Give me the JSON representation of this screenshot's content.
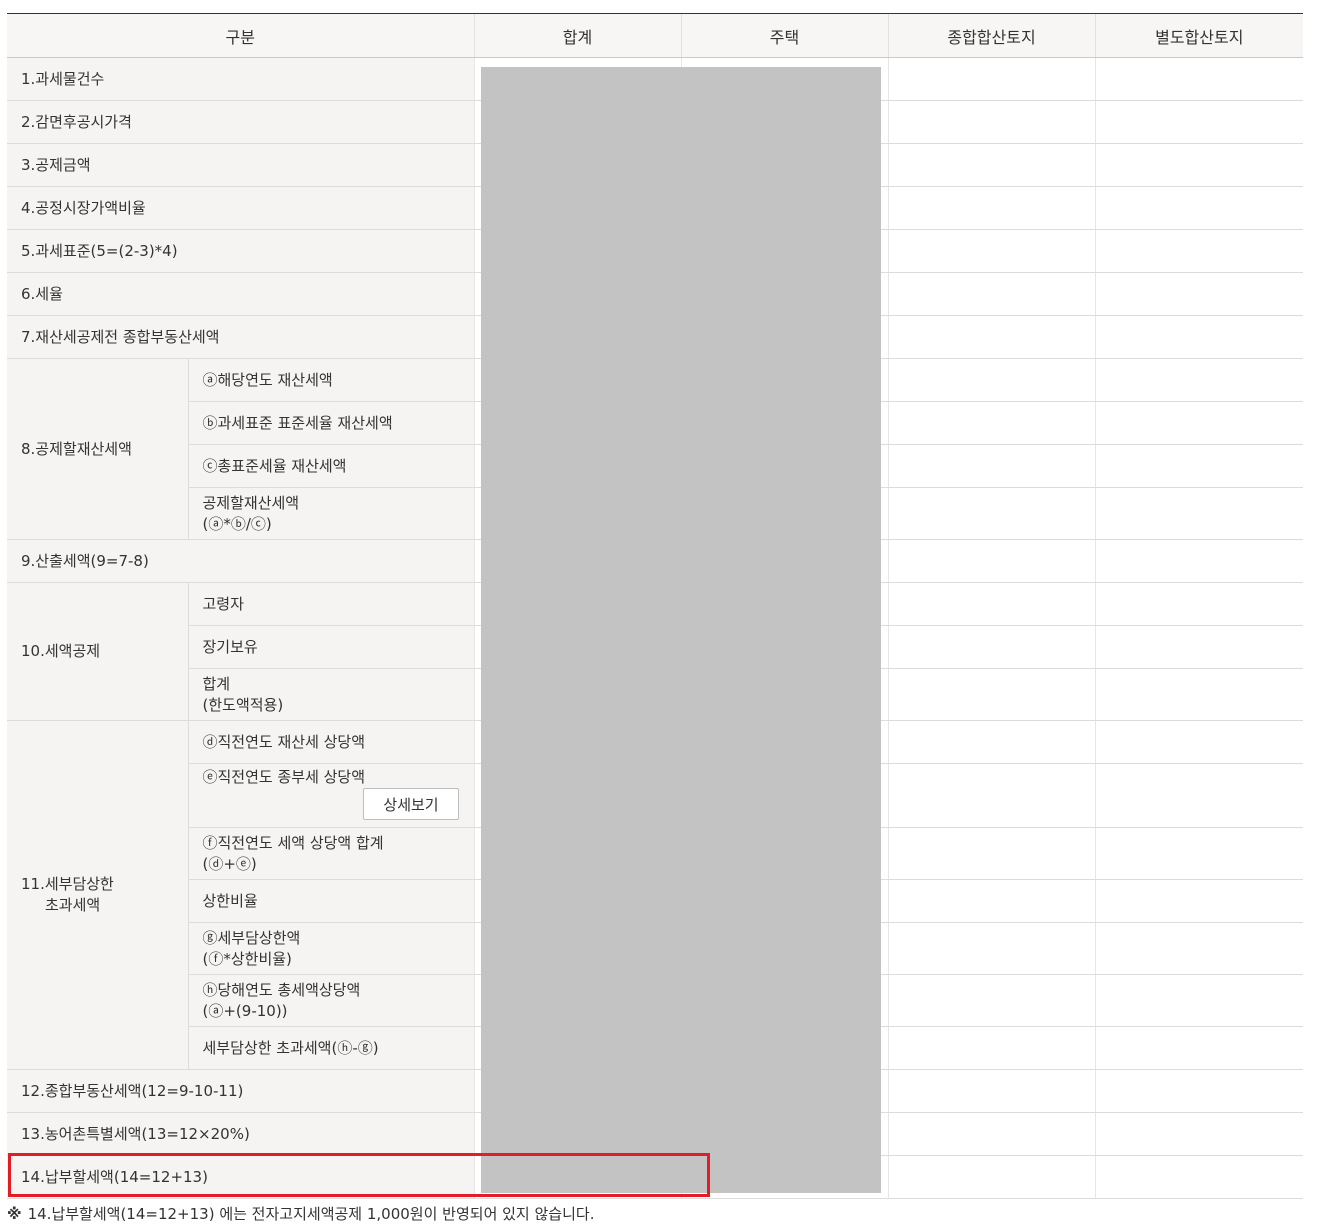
{
  "headers": [
    "구분",
    "합계",
    "주택",
    "종합합산토지",
    "별도합산토지"
  ],
  "rows": {
    "r1": "1.과세물건수",
    "r2": "2.감면후공시가격",
    "r3": "3.공제금액",
    "r4": "4.공정시장가액비율",
    "r5": "5.과세표준(5=(2-3)*4)",
    "r6": "6.세율",
    "r7": "7.재산세공제전 종합부동산세액",
    "r8": {
      "group": "8.공제할재산세액",
      "a": "ⓐ해당연도 재산세액",
      "b": "ⓑ과세표준 표준세율 재산세액",
      "c": "ⓒ총표준세율 재산세액",
      "d_line1": "공제할재산세액",
      "d_line2": "(ⓐ*ⓑ/ⓒ)"
    },
    "r9": "9.산출세액(9=7-8)",
    "r10": {
      "group": "10.세액공제",
      "a": "고령자",
      "b": "장기보유",
      "c_line1": "합계",
      "c_line2": "(한도액적용)"
    },
    "r11": {
      "group_line1": "11.세부담상한",
      "group_line2": "초과세액",
      "d": "ⓓ직전연도 재산세 상당액",
      "e": "ⓔ직전연도 종부세 상당액",
      "e_button": "상세보기",
      "f_line1": "ⓕ직전연도 세액 상당액 합계",
      "f_line2": "(ⓓ+ⓔ)",
      "ratio": "상한비율",
      "g_line1": "ⓖ세부담상한액",
      "g_line2": "(ⓕ*상한비율)",
      "h_line1": "ⓗ당해연도 총세액상당액",
      "h_line2": "(ⓐ+(9-10))",
      "excess": "세부담상한 초과세액(ⓗ-ⓖ)"
    },
    "r12": "12.종합부동산세액(12=9-10-11)",
    "r13": "13.농어촌특별세액(13=12×20%)",
    "r14": "14.납부할세액(14=12+13)"
  },
  "footnote": {
    "mark": "※",
    "text": "14.납부할세액(14=12+13) 에는 전자고지세액공제 1,000원이 반영되어 있지 않습니다."
  },
  "colors": {
    "highlight": "#e21d25",
    "mask": "#c3c3c3",
    "label_bg": "#f5f4f2"
  }
}
